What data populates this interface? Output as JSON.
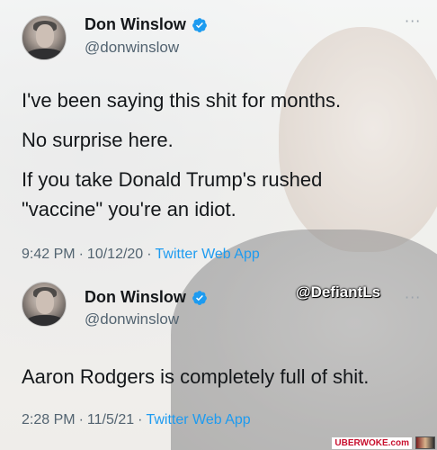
{
  "tweets": [
    {
      "display_name": "Don Winslow",
      "handle": "@donwinslow",
      "lines": [
        "I've been saying this shit for months.",
        "No surprise here.",
        "If you take Donald Trump's rushed",
        "\"vaccine\" you're an idiot."
      ],
      "time": "9:42 PM",
      "date": "10/12/20",
      "app": "Twitter Web App"
    },
    {
      "display_name": "Don Winslow",
      "handle": "@donwinslow",
      "lines": [
        "Aaron Rodgers is completely full of shit."
      ],
      "time": "2:28 PM",
      "date": "11/5/21",
      "app": "Twitter Web App"
    }
  ],
  "separator": "·",
  "more_glyph": "···",
  "watermark": "@DefiantLs",
  "footer": {
    "brand": "UBERWOKE.com"
  },
  "icons": {
    "verified": "verified-badge-icon",
    "more": "more-options-icon",
    "avatar": "profile-avatar"
  },
  "colors": {
    "verified": "#1d9bf0",
    "link": "#1d9bf0",
    "meta": "#536471",
    "text": "#14171a",
    "brand": "#c8102e"
  }
}
